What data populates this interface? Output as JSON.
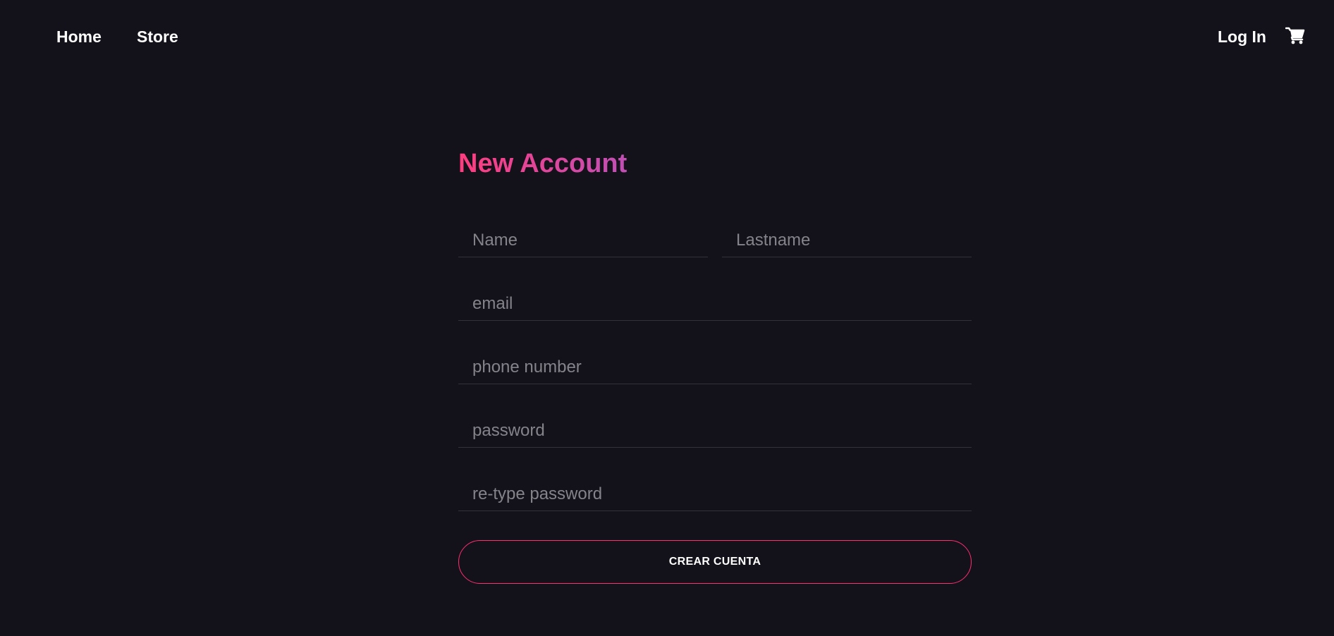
{
  "nav": {
    "home_label": "Home",
    "store_label": "Store",
    "login_label": "Log In",
    "cart_icon": "shopping-cart-icon"
  },
  "form": {
    "title": "New Account",
    "title_gradient": [
      "#ff3d7f",
      "#c04fb5"
    ],
    "name_placeholder": "Name",
    "lastname_placeholder": "Lastname",
    "email_placeholder": "email",
    "phone_placeholder": "phone number",
    "password_placeholder": "password",
    "retype_placeholder": "re-type password",
    "submit_label": "CREAR CUENTA"
  },
  "colors": {
    "background": "#13111a",
    "accent": "#ff2e6e",
    "text": "#ffffff",
    "placeholder": "#85838a",
    "field_border": "#34313c"
  }
}
